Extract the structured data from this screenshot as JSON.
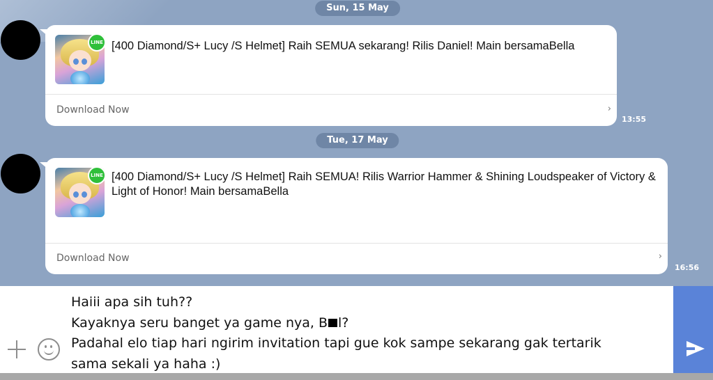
{
  "chat": {
    "dates": [
      "Sun, 15 May",
      "Tue, 17 May"
    ],
    "messages": [
      {
        "text": "[400 Diamond/S+ Lucy /S Helmet] Raih SEMUA sekarang! Rilis Daniel! Main bersamaBella",
        "action_label": "Download Now",
        "time": "13:55",
        "badge": "LINE"
      },
      {
        "text": "[400 Diamond/S+ Lucy /S Helmet] Raih SEMUA! Rilis Warrior Hammer & Shining Loudspeaker of Victory & Light of Honor! Main bersamaBella",
        "action_label": "Download Now",
        "time": "16:56",
        "badge": "LINE"
      }
    ]
  },
  "composer": {
    "lines": [
      "Haiii apa sih tuh??",
      "Kayaknya seru banget ya game nya, B",
      "l?",
      "Padahal elo tiap hari ngirim invitation tapi gue kok sampe sekarang gak tertarik",
      "sama sekali ya haha :)"
    ],
    "icons": [
      "plus-icon",
      "smile-icon",
      "send-icon"
    ]
  },
  "colors": {
    "chat_background": "#8ea4c2",
    "date_pill": "#6f86a6",
    "send_button": "#5a83d8",
    "line_badge": "#2fbf3a"
  }
}
